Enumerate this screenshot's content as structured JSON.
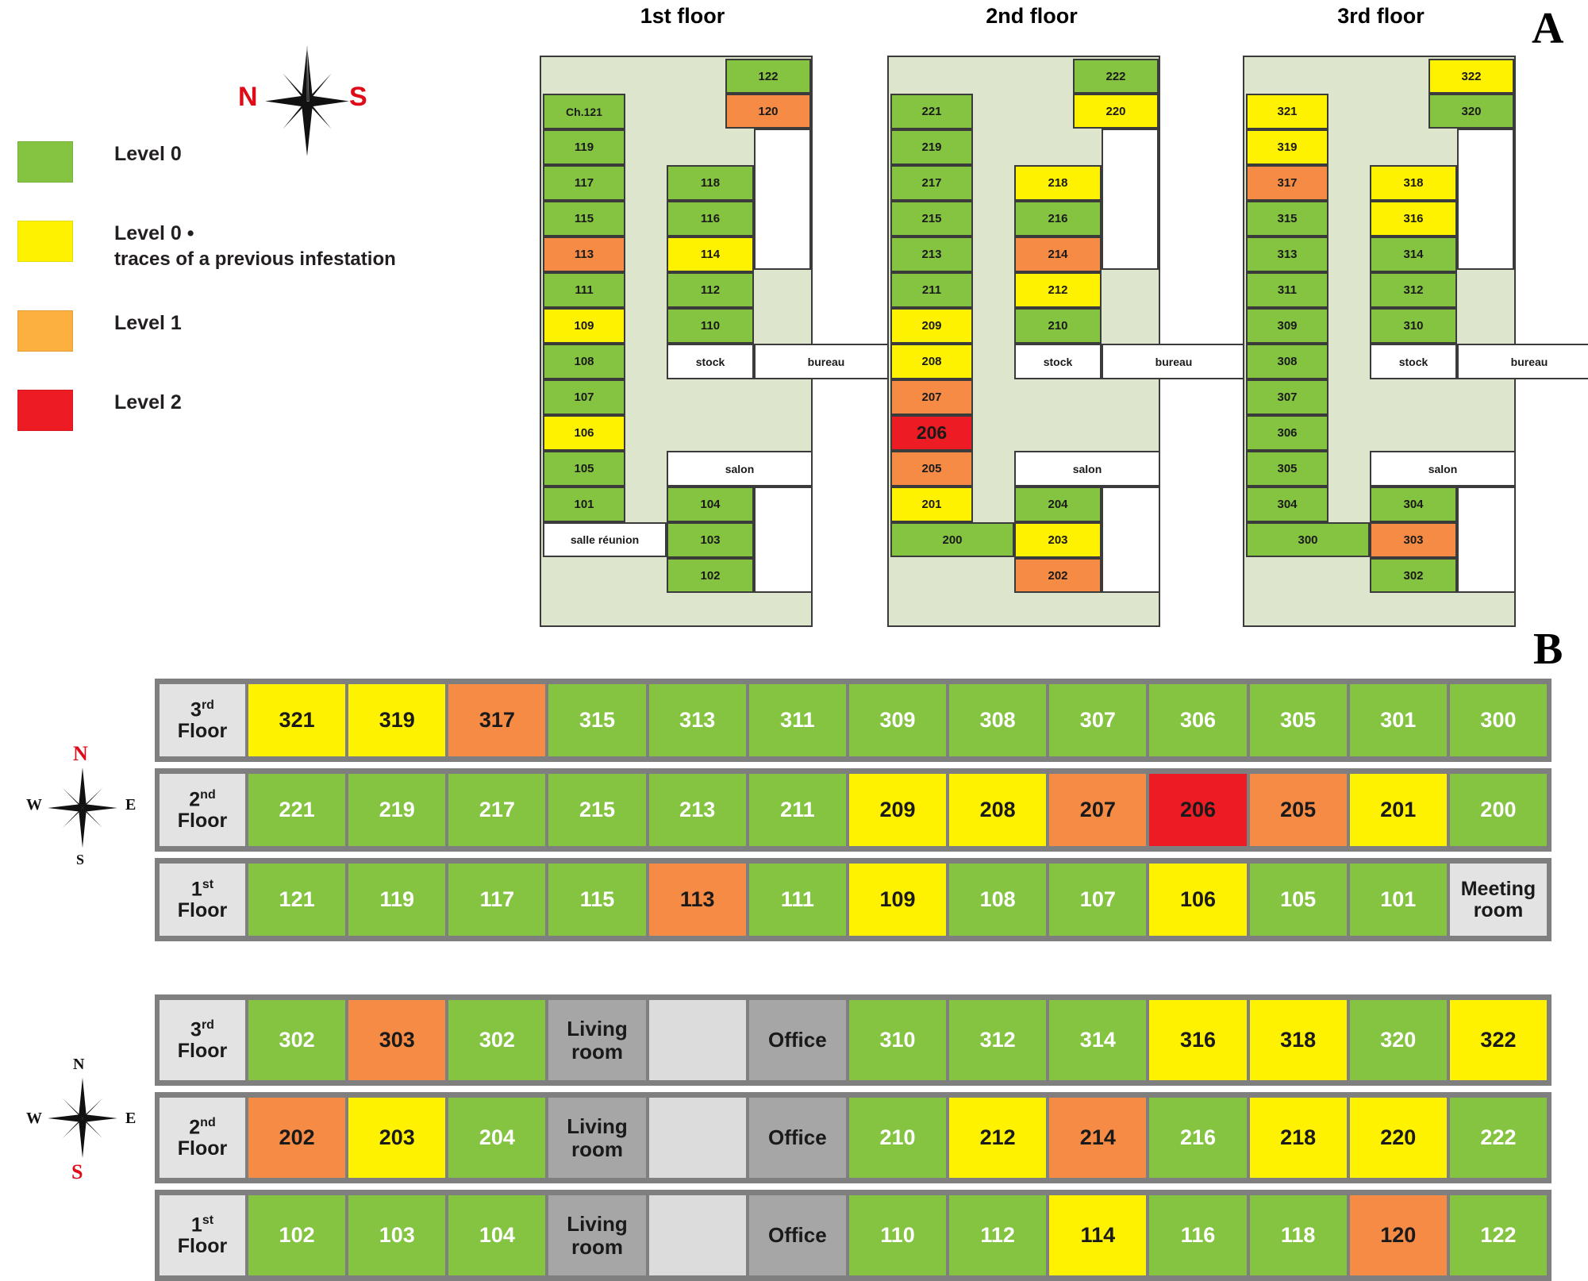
{
  "panels": {
    "a_label": "A",
    "b_label": "B"
  },
  "legend": {
    "items": [
      {
        "color": "#84c441",
        "label": "Level 0",
        "sub": ""
      },
      {
        "color": "#fff200",
        "label": "Level 0 •",
        "sub": "traces of a previous infestation"
      },
      {
        "color": "#fbb040",
        "label": "Level 1",
        "sub": ""
      },
      {
        "color": "#ed1c24",
        "label": "Level 2",
        "sub": ""
      }
    ]
  },
  "colors": {
    "green": "#84c441",
    "yellow": "#fff200",
    "orange_plan": "#f58b45",
    "orange_legend": "#fbb040",
    "red": "#ed1c24",
    "corridor": "#dde5cd",
    "white": "#ffffff",
    "gray_mid": "#a6a6a6",
    "gray_light": "#dcdcdc",
    "gray_label": "#e3e3e3",
    "border_gray": "#7f7f7f",
    "compass_red": "#e00b18"
  },
  "compass_a": {
    "left_label": "N",
    "right_label": "S"
  },
  "compass_b_top": {
    "n": "N",
    "s": "S",
    "w": "W",
    "e": "E"
  },
  "compass_b_bottom": {
    "n": "N",
    "s": "S",
    "w": "W",
    "e": "E"
  },
  "floor_plans": [
    {
      "title_main": "1st floor",
      "title_num": "1st",
      "left_col": [
        {
          "label": "Ch.121",
          "level": "green"
        },
        {
          "label": "119",
          "level": "green"
        },
        {
          "label": "117",
          "level": "green"
        },
        {
          "label": "115",
          "level": "green"
        },
        {
          "label": "113",
          "level": "orange"
        },
        {
          "label": "111",
          "level": "green"
        },
        {
          "label": "109",
          "level": "yellow"
        },
        {
          "label": "108",
          "level": "green"
        },
        {
          "label": "107",
          "level": "green"
        },
        {
          "label": "106",
          "level": "yellow"
        },
        {
          "label": "105",
          "level": "green"
        },
        {
          "label": "101",
          "level": "green"
        }
      ],
      "bottom_left": {
        "label": "salle réunion",
        "level": "white"
      },
      "mid_col": [
        {
          "label": "118",
          "level": "green"
        },
        {
          "label": "116",
          "level": "green"
        },
        {
          "label": "114",
          "level": "yellow"
        },
        {
          "label": "112",
          "level": "green"
        },
        {
          "label": "110",
          "level": "green"
        }
      ],
      "stock": {
        "label": "stock",
        "level": "white"
      },
      "bureau": {
        "label": "bureau",
        "level": "white"
      },
      "salon": {
        "label": "salon",
        "level": "white"
      },
      "mid_col_bottom": [
        {
          "label": "104",
          "level": "green"
        },
        {
          "label": "103",
          "level": "green"
        },
        {
          "label": "102",
          "level": "green"
        }
      ],
      "right_top": [
        {
          "label": "122",
          "level": "green"
        },
        {
          "label": "120",
          "level": "orange"
        }
      ]
    },
    {
      "title_main": "2nd floor",
      "title_num": "2nd",
      "left_col": [
        {
          "label": "221",
          "level": "green"
        },
        {
          "label": "219",
          "level": "green"
        },
        {
          "label": "217",
          "level": "green"
        },
        {
          "label": "215",
          "level": "green"
        },
        {
          "label": "213",
          "level": "green"
        },
        {
          "label": "211",
          "level": "green"
        },
        {
          "label": "209",
          "level": "yellow"
        },
        {
          "label": "208",
          "level": "yellow"
        },
        {
          "label": "207",
          "level": "orange"
        },
        {
          "label": "206",
          "level": "red",
          "big": true
        },
        {
          "label": "205",
          "level": "orange"
        },
        {
          "label": "201",
          "level": "yellow"
        }
      ],
      "bottom_left": {
        "label": "200",
        "level": "green"
      },
      "mid_col": [
        {
          "label": "218",
          "level": "yellow"
        },
        {
          "label": "216",
          "level": "green"
        },
        {
          "label": "214",
          "level": "orange"
        },
        {
          "label": "212",
          "level": "yellow"
        },
        {
          "label": "210",
          "level": "green"
        }
      ],
      "stock": {
        "label": "stock",
        "level": "white"
      },
      "bureau": {
        "label": "bureau",
        "level": "white"
      },
      "salon": {
        "label": "salon",
        "level": "white"
      },
      "mid_col_bottom": [
        {
          "label": "204",
          "level": "green"
        },
        {
          "label": "203",
          "level": "yellow"
        },
        {
          "label": "202",
          "level": "orange"
        }
      ],
      "right_top": [
        {
          "label": "222",
          "level": "green"
        },
        {
          "label": "220",
          "level": "yellow"
        }
      ]
    },
    {
      "title_main": "3rd floor",
      "title_num": "3rd",
      "left_col": [
        {
          "label": "321",
          "level": "yellow"
        },
        {
          "label": "319",
          "level": "yellow"
        },
        {
          "label": "317",
          "level": "orange"
        },
        {
          "label": "315",
          "level": "green"
        },
        {
          "label": "313",
          "level": "green"
        },
        {
          "label": "311",
          "level": "green"
        },
        {
          "label": "309",
          "level": "green"
        },
        {
          "label": "308",
          "level": "green"
        },
        {
          "label": "307",
          "level": "green"
        },
        {
          "label": "306",
          "level": "green"
        },
        {
          "label": "305",
          "level": "green"
        },
        {
          "label": "304",
          "level": "green"
        }
      ],
      "bottom_left": {
        "label": "300",
        "level": "green"
      },
      "mid_col": [
        {
          "label": "318",
          "level": "yellow"
        },
        {
          "label": "316",
          "level": "yellow"
        },
        {
          "label": "314",
          "level": "green"
        },
        {
          "label": "312",
          "level": "green"
        },
        {
          "label": "310",
          "level": "green"
        }
      ],
      "stock": {
        "label": "stock",
        "level": "white"
      },
      "bureau": {
        "label": "bureau",
        "level": "white"
      },
      "salon": {
        "label": "salon",
        "level": "white"
      },
      "mid_col_bottom": [
        {
          "label": "304",
          "level": "green"
        },
        {
          "label": "303",
          "level": "orange"
        },
        {
          "label": "302",
          "level": "green"
        }
      ],
      "right_top": [
        {
          "label": "322",
          "level": "yellow"
        },
        {
          "label": "320",
          "level": "green"
        }
      ]
    }
  ],
  "panel_b": {
    "block_top": {
      "rows": [
        {
          "floor_sup": "rd",
          "floor_num": "3",
          "floor_word": "Floor",
          "cells": [
            {
              "label": "321",
              "level": "yellow"
            },
            {
              "label": "319",
              "level": "yellow"
            },
            {
              "label": "317",
              "level": "orange"
            },
            {
              "label": "315",
              "level": "green"
            },
            {
              "label": "313",
              "level": "green"
            },
            {
              "label": "311",
              "level": "green"
            },
            {
              "label": "309",
              "level": "green"
            },
            {
              "label": "308",
              "level": "green"
            },
            {
              "label": "307",
              "level": "green"
            },
            {
              "label": "306",
              "level": "green"
            },
            {
              "label": "305",
              "level": "green"
            },
            {
              "label": "301",
              "level": "green"
            },
            {
              "label": "300",
              "level": "green"
            }
          ]
        },
        {
          "floor_sup": "nd",
          "floor_num": "2",
          "floor_word": "Floor",
          "cells": [
            {
              "label": "221",
              "level": "green"
            },
            {
              "label": "219",
              "level": "green"
            },
            {
              "label": "217",
              "level": "green"
            },
            {
              "label": "215",
              "level": "green"
            },
            {
              "label": "213",
              "level": "green"
            },
            {
              "label": "211",
              "level": "green"
            },
            {
              "label": "209",
              "level": "yellow"
            },
            {
              "label": "208",
              "level": "yellow"
            },
            {
              "label": "207",
              "level": "orange"
            },
            {
              "label": "206",
              "level": "red"
            },
            {
              "label": "205",
              "level": "orange"
            },
            {
              "label": "201",
              "level": "yellow"
            },
            {
              "label": "200",
              "level": "green"
            }
          ]
        },
        {
          "floor_sup": "st",
          "floor_num": "1",
          "floor_word": "Floor",
          "cells": [
            {
              "label": "121",
              "level": "green"
            },
            {
              "label": "119",
              "level": "green"
            },
            {
              "label": "117",
              "level": "green"
            },
            {
              "label": "115",
              "level": "green"
            },
            {
              "label": "113",
              "level": "orange"
            },
            {
              "label": "111",
              "level": "green"
            },
            {
              "label": "109",
              "level": "yellow"
            },
            {
              "label": "108",
              "level": "green"
            },
            {
              "label": "107",
              "level": "green"
            },
            {
              "label": "106",
              "level": "yellow"
            },
            {
              "label": "105",
              "level": "green"
            },
            {
              "label": "101",
              "level": "green"
            },
            {
              "label": "Meeting room",
              "level": "meeting"
            }
          ]
        }
      ]
    },
    "block_bottom": {
      "rows": [
        {
          "floor_sup": "rd",
          "floor_num": "3",
          "floor_word": "Floor",
          "cells": [
            {
              "label": "302",
              "level": "green"
            },
            {
              "label": "303",
              "level": "orange"
            },
            {
              "label": "302",
              "level": "green"
            },
            {
              "label": "Living room",
              "level": "gray"
            },
            {
              "label": "",
              "level": "lgray"
            },
            {
              "label": "Office",
              "level": "gray"
            },
            {
              "label": "310",
              "level": "green"
            },
            {
              "label": "312",
              "level": "green"
            },
            {
              "label": "314",
              "level": "green"
            },
            {
              "label": "316",
              "level": "yellow"
            },
            {
              "label": "318",
              "level": "yellow"
            },
            {
              "label": "320",
              "level": "green"
            },
            {
              "label": "322",
              "level": "yellow"
            }
          ]
        },
        {
          "floor_sup": "nd",
          "floor_num": "2",
          "floor_word": "Floor",
          "cells": [
            {
              "label": "202",
              "level": "orange"
            },
            {
              "label": "203",
              "level": "yellow"
            },
            {
              "label": "204",
              "level": "green"
            },
            {
              "label": "Living room",
              "level": "gray"
            },
            {
              "label": "",
              "level": "lgray"
            },
            {
              "label": "Office",
              "level": "gray"
            },
            {
              "label": "210",
              "level": "green"
            },
            {
              "label": "212",
              "level": "yellow"
            },
            {
              "label": "214",
              "level": "orange"
            },
            {
              "label": "216",
              "level": "green"
            },
            {
              "label": "218",
              "level": "yellow"
            },
            {
              "label": "220",
              "level": "yellow"
            },
            {
              "label": "222",
              "level": "green"
            }
          ]
        },
        {
          "floor_sup": "st",
          "floor_num": "1",
          "floor_word": "Floor",
          "cells": [
            {
              "label": "102",
              "level": "green"
            },
            {
              "label": "103",
              "level": "green"
            },
            {
              "label": "104",
              "level": "green"
            },
            {
              "label": "Living room",
              "level": "gray"
            },
            {
              "label": "",
              "level": "lgray"
            },
            {
              "label": "Office",
              "level": "gray"
            },
            {
              "label": "110",
              "level": "green"
            },
            {
              "label": "112",
              "level": "green"
            },
            {
              "label": "114",
              "level": "yellow"
            },
            {
              "label": "116",
              "level": "green"
            },
            {
              "label": "118",
              "level": "green"
            },
            {
              "label": "120",
              "level": "orange"
            },
            {
              "label": "122",
              "level": "green"
            }
          ]
        }
      ]
    }
  }
}
